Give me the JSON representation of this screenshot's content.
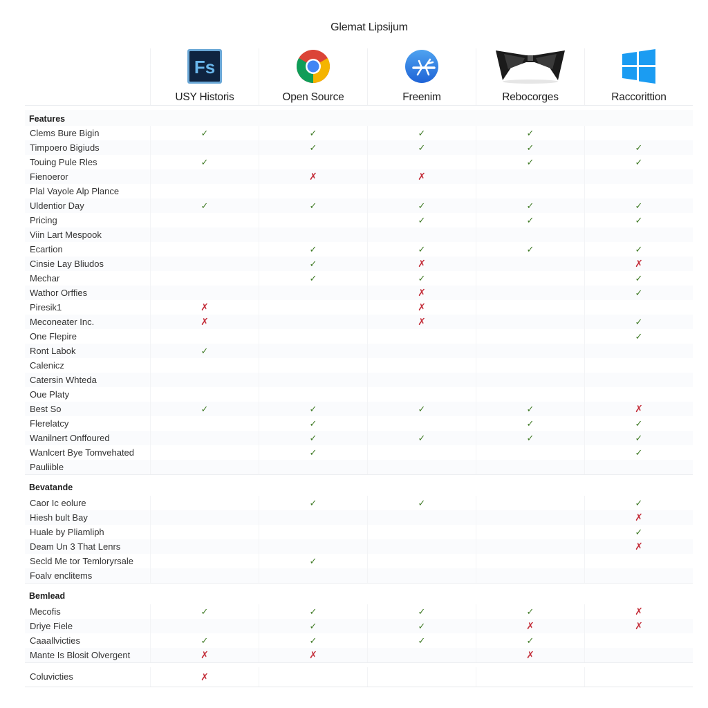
{
  "title": "Glemat Lipsijum",
  "columns": [
    {
      "name": "USY Historis",
      "icon": "fs-app-icon"
    },
    {
      "name": "Open Source",
      "icon": "chrome-browser-icon"
    },
    {
      "name": "Freenim",
      "icon": "blue-circle-app-icon"
    },
    {
      "name": "Rebocorges",
      "icon": "black-bowtie-icon"
    },
    {
      "name": "Raccorittion",
      "icon": "windows-logo-icon"
    }
  ],
  "icons": {
    "fs_text": "Fs",
    "check": "✓",
    "cross": "✗"
  },
  "colors": {
    "check": "#3f7a25",
    "cross": "#c42f3b",
    "fs_bg": "#0f2440",
    "fs_text": "#6ab7ec",
    "windows_blue": "#1b9cf2"
  },
  "sections": [
    {
      "title": "Features",
      "rows": [
        {
          "label": "Clems Bure Bigin",
          "values": [
            "check",
            "check",
            "check",
            "check",
            ""
          ]
        },
        {
          "label": "Timpoero Bigiuds",
          "values": [
            "",
            "check",
            "check",
            "check",
            "check"
          ]
        },
        {
          "label": "Touing Pule Rles",
          "values": [
            "check",
            "",
            "",
            "check",
            "check"
          ]
        },
        {
          "label": "Fienoeror",
          "values": [
            "",
            "cross",
            "cross",
            "",
            ""
          ]
        },
        {
          "label": "Plal Vayole Alp Plance",
          "values": [
            "",
            "",
            "",
            "",
            ""
          ]
        },
        {
          "label": "Uldentior Day",
          "values": [
            "check",
            "check",
            "check",
            "check",
            "check"
          ]
        },
        {
          "label": "Pricing",
          "values": [
            "",
            "",
            "check",
            "check",
            "check"
          ]
        },
        {
          "label": "Viin Lart Mespook",
          "values": [
            "",
            "",
            "",
            "",
            ""
          ]
        },
        {
          "label": "Ecartion",
          "values": [
            "",
            "check",
            "check",
            "check",
            "check"
          ]
        },
        {
          "label": "Cinsie Lay Bliudos",
          "values": [
            "",
            "check",
            "cross",
            "",
            "cross"
          ]
        },
        {
          "label": "Mechar",
          "values": [
            "",
            "check",
            "check",
            "",
            "check"
          ]
        },
        {
          "label": "Wathor Orffies",
          "values": [
            "",
            "",
            "cross",
            "",
            "check"
          ]
        },
        {
          "label": "Piresik1",
          "values": [
            "cross",
            "",
            "cross",
            "",
            ""
          ]
        },
        {
          "label": "Meconeater Inc.",
          "values": [
            "cross",
            "",
            "cross",
            "",
            "check"
          ]
        },
        {
          "label": "One Flepire",
          "values": [
            "",
            "",
            "",
            "",
            "check"
          ]
        },
        {
          "label": "Ront Labok",
          "values": [
            "check",
            "",
            "",
            "",
            ""
          ]
        },
        {
          "label": "Calenicz",
          "values": [
            "",
            "",
            "",
            "",
            ""
          ]
        },
        {
          "label": "Catersin Whteda",
          "values": [
            "",
            "",
            "",
            "",
            ""
          ]
        },
        {
          "label": "Oue Platy",
          "values": [
            "",
            "",
            "",
            "",
            ""
          ]
        },
        {
          "label": "Best So",
          "values": [
            "check",
            "check",
            "check",
            "check",
            "cross"
          ]
        },
        {
          "label": "Flerelatcy",
          "values": [
            "",
            "check",
            "",
            "check",
            "check"
          ]
        },
        {
          "label": "Wanilnert Onffoured",
          "values": [
            "",
            "check",
            "check",
            "check",
            "check"
          ]
        },
        {
          "label": "Wanlcert Bye Tomvehated",
          "values": [
            "",
            "check",
            "",
            "",
            "check"
          ]
        },
        {
          "label": "Pauliible",
          "values": [
            "",
            "",
            "",
            "",
            ""
          ]
        }
      ]
    },
    {
      "title": "Bevatande",
      "rows": [
        {
          "label": "Caor Ic eolure",
          "values": [
            "",
            "check",
            "check",
            "",
            "check"
          ]
        },
        {
          "label": "Hiesh bult Bay",
          "values": [
            "",
            "",
            "",
            "",
            "cross"
          ]
        },
        {
          "label": "Huale by Pliamliph",
          "values": [
            "",
            "",
            "",
            "",
            "check"
          ]
        },
        {
          "label": "Deam Un 3 That Lenrs",
          "values": [
            "",
            "",
            "",
            "",
            "cross"
          ]
        },
        {
          "label": "Secld Me tor Temloryrsale",
          "values": [
            "",
            "check",
            "",
            "",
            ""
          ]
        },
        {
          "label": "Foalv enclitems",
          "values": [
            "",
            "",
            "",
            "",
            ""
          ]
        }
      ]
    },
    {
      "title": "Bemlead",
      "rows": [
        {
          "label": "Mecofis",
          "values": [
            "check",
            "check",
            "check",
            "check",
            "cross"
          ]
        },
        {
          "label": "Driye Fiele",
          "values": [
            "",
            "check",
            "check",
            "cross",
            "cross"
          ]
        },
        {
          "label": "Caaallvicties",
          "values": [
            "check",
            "check",
            "check",
            "check",
            ""
          ]
        },
        {
          "label": "Mante Is Blosit Olvergent",
          "values": [
            "cross",
            "cross",
            "",
            "cross",
            ""
          ]
        }
      ]
    },
    {
      "title": "",
      "rows": [
        {
          "label": "Coluvicties",
          "values": [
            "cross",
            "",
            "",
            "",
            ""
          ]
        }
      ]
    }
  ]
}
